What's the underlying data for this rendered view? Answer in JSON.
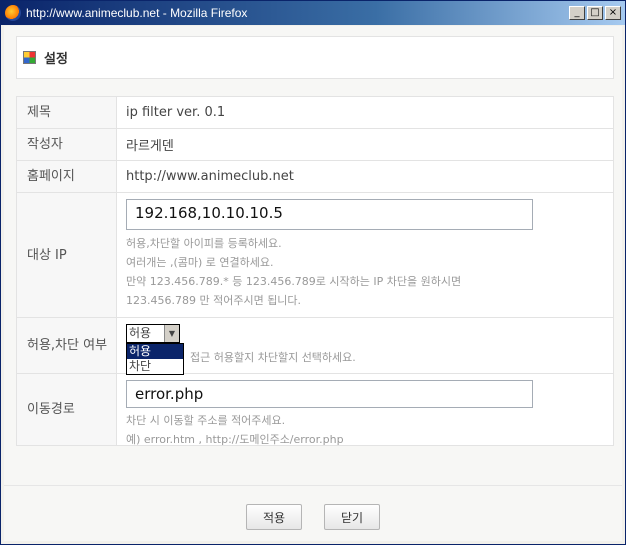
{
  "window": {
    "title": "http://www.animeclub.net - Mozilla Firefox",
    "minimize": "_",
    "maximize": "□",
    "close": "×"
  },
  "header": {
    "title": "설정"
  },
  "form": {
    "title_label": "제목",
    "title_value": "ip filter ver. 0.1",
    "author_label": "작성자",
    "author_value": "라르게덴",
    "homepage_label": "홈페이지",
    "homepage_value": "http://www.animeclub.net",
    "target_label": "대상 IP",
    "target_value": "192.168,10.10.10.5",
    "target_help": [
      "허용,차단할 아이피를 등록하세요.",
      "여러개는 ,(콤마) 로 연결하세요.",
      "만약 123.456.789.* 등 123.456.789로 시작하는 IP 차단을 원하시면",
      "123.456.789 만 적어주시면 됩니다."
    ],
    "allow_label": "허용,차단 여부",
    "allow_selected": "허용",
    "allow_options": [
      "허용",
      "차단"
    ],
    "allow_help": "접근 허용할지 차단할지 선택하세요.",
    "redirect_label": "이동경로",
    "redirect_value": "error.php",
    "redirect_help": [
      "차단 시 이동할 주소를 적어주세요.",
      "예) error.htm , http://도메인주소/error.php"
    ]
  },
  "buttons": {
    "apply": "적용",
    "close": "닫기"
  }
}
